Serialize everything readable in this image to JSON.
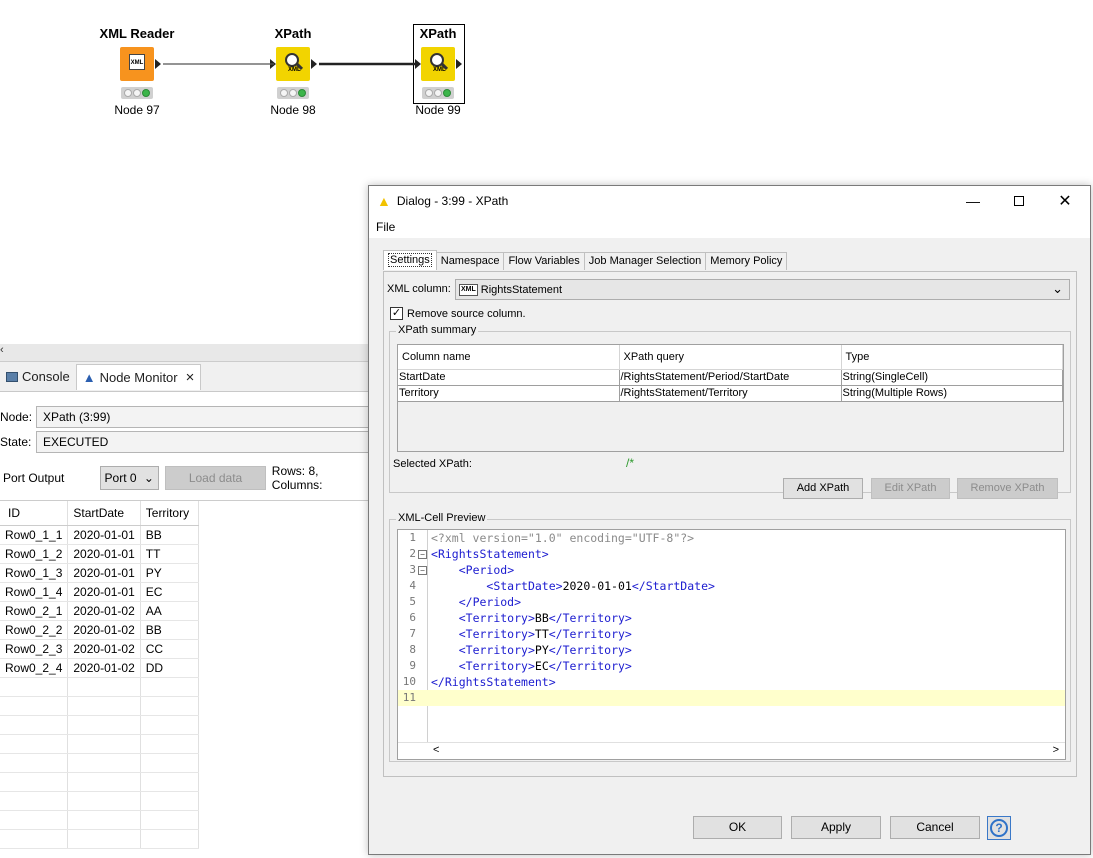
{
  "workflow": {
    "nodes": [
      {
        "title": "XML Reader",
        "label": "Node 97",
        "icon": "xml-reader-icon"
      },
      {
        "title": "XPath",
        "label": "Node 98",
        "icon": "xpath-icon"
      },
      {
        "title": "XPath",
        "label": "Node 99",
        "icon": "xpath-icon"
      }
    ]
  },
  "left_panel": {
    "tabs": [
      {
        "label": "Console",
        "icon": "console-icon"
      },
      {
        "label": "Node Monitor",
        "icon": "node-monitor-icon",
        "close": "×"
      }
    ],
    "node_label": "Node:",
    "node_value": "XPath  (3:99)",
    "state_label": "State:",
    "state_value": "EXECUTED",
    "port_output_label": "Port Output",
    "port_select": "Port 0",
    "load_data_button": "Load data",
    "rows_info": "Rows: 8, Columns:",
    "table": {
      "columns": [
        "ID",
        "StartDate",
        "Territory"
      ],
      "rows": [
        [
          "Row0_1_1",
          "2020-01-01",
          "BB"
        ],
        [
          "Row0_1_2",
          "2020-01-01",
          "TT"
        ],
        [
          "Row0_1_3",
          "2020-01-01",
          "PY"
        ],
        [
          "Row0_1_4",
          "2020-01-01",
          "EC"
        ],
        [
          "Row0_2_1",
          "2020-01-02",
          "AA"
        ],
        [
          "Row0_2_2",
          "2020-01-02",
          "BB"
        ],
        [
          "Row0_2_3",
          "2020-01-02",
          "CC"
        ],
        [
          "Row0_2_4",
          "2020-01-02",
          "DD"
        ]
      ]
    }
  },
  "dialog": {
    "title": "Dialog - 3:99 - XPath",
    "menu": [
      "File"
    ],
    "tabs": [
      "Settings",
      "Namespace",
      "Flow Variables",
      "Job Manager Selection",
      "Memory Policy"
    ],
    "xml_column_label": "XML column:",
    "xml_column_badge": "XML",
    "xml_column_value": "RightsStatement",
    "remove_source_label": "Remove source column.",
    "remove_source_checked": true,
    "summary": {
      "legend": "XPath summary",
      "columns": [
        "Column name",
        "XPath query",
        "Type"
      ],
      "rows": [
        [
          "StartDate",
          "/RightsStatement/Period/StartDate",
          "String(SingleCell)"
        ],
        [
          "Territory",
          "/RightsStatement/Territory",
          "String(Multiple Rows)"
        ]
      ],
      "selected_label": "Selected XPath:",
      "selected_value": "/*",
      "add_button": "Add XPath",
      "edit_button": "Edit XPath",
      "remove_button": "Remove XPath"
    },
    "preview": {
      "legend": "XML-Cell Preview",
      "line_numbers": [
        "1",
        "2",
        "3",
        "4",
        "5",
        "6",
        "7",
        "8",
        "9",
        "10",
        "11"
      ],
      "lines": [
        "<?xml version=\"1.0\" encoding=\"UTF-8\"?>",
        "<RightsStatement>",
        "    <Period>",
        "        <StartDate>2020-01-01</StartDate>",
        "    </Period>",
        "    <Territory>BB</Territory>",
        "    <Territory>TT</Territory>",
        "    <Territory>PY</Territory>",
        "    <Territory>EC</Territory>",
        "</RightsStatement>",
        ""
      ],
      "scroll_left": "<",
      "scroll_right": ">"
    },
    "ok_button": "OK",
    "apply_button": "Apply",
    "cancel_button": "Cancel",
    "help_icon": "?",
    "colors": {
      "highlight_line": "#ffffcc",
      "selected_xpath": "#2e9a2e",
      "tag": "#1c1cd0",
      "tag_name": "#a52a2a"
    }
  }
}
